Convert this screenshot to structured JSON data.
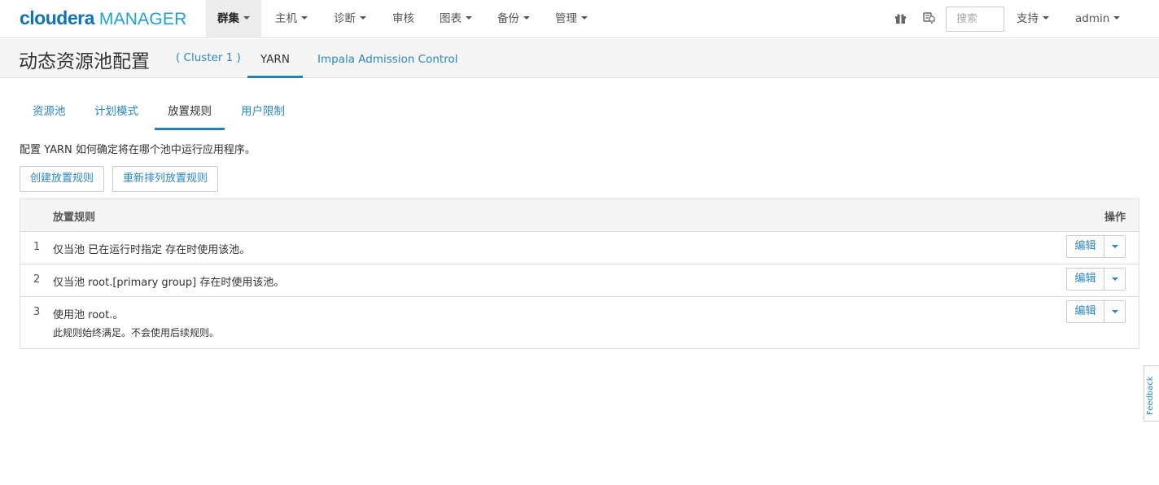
{
  "brand": {
    "name": "cloudera",
    "product": "MANAGER"
  },
  "nav": {
    "items": [
      {
        "label": "群集",
        "dropdown": true,
        "active": true
      },
      {
        "label": "主机",
        "dropdown": true
      },
      {
        "label": "诊断",
        "dropdown": true
      },
      {
        "label": "审核",
        "dropdown": false
      },
      {
        "label": "图表",
        "dropdown": true
      },
      {
        "label": "备份",
        "dropdown": true
      },
      {
        "label": "管理",
        "dropdown": true
      }
    ],
    "search_placeholder": "搜索",
    "support_label": "支持",
    "user_label": "admin"
  },
  "header": {
    "title": "动态资源池配置",
    "cluster": "( Cluster 1 )",
    "tabs": [
      {
        "label": "YARN",
        "active": true
      },
      {
        "label": "Impala Admission Control"
      }
    ]
  },
  "section_tabs": [
    {
      "label": "资源池"
    },
    {
      "label": "计划模式"
    },
    {
      "label": "放置规则",
      "active": true
    },
    {
      "label": "用户限制"
    }
  ],
  "description": "配置 YARN 如何确定将在哪个池中运行应用程序。",
  "buttons": {
    "create": "创建放置规则",
    "reorder": "重新排列放置规则"
  },
  "table": {
    "headers": {
      "rule": "放置规则",
      "actions": "操作"
    },
    "rows": [
      {
        "index": "1",
        "text": "仅当池 已在运行时指定 存在时使用该池。",
        "note": "",
        "edit": "编辑"
      },
      {
        "index": "2",
        "text": "仅当池 root.[primary group] 存在时使用该池。",
        "note": "",
        "edit": "编辑"
      },
      {
        "index": "3",
        "text": "使用池 root.。",
        "note": "此规则始终满足。不会使用后续规则。",
        "edit": "编辑"
      }
    ]
  },
  "feedback_label": "Feedback",
  "colors": {
    "accent": "#1784c7",
    "link": "#2a88c6",
    "brand_dark": "#0f74b6",
    "brand_light": "#1aa3d8"
  },
  "icons": {
    "gift": "gift-icon",
    "notification": "bell-icon"
  }
}
